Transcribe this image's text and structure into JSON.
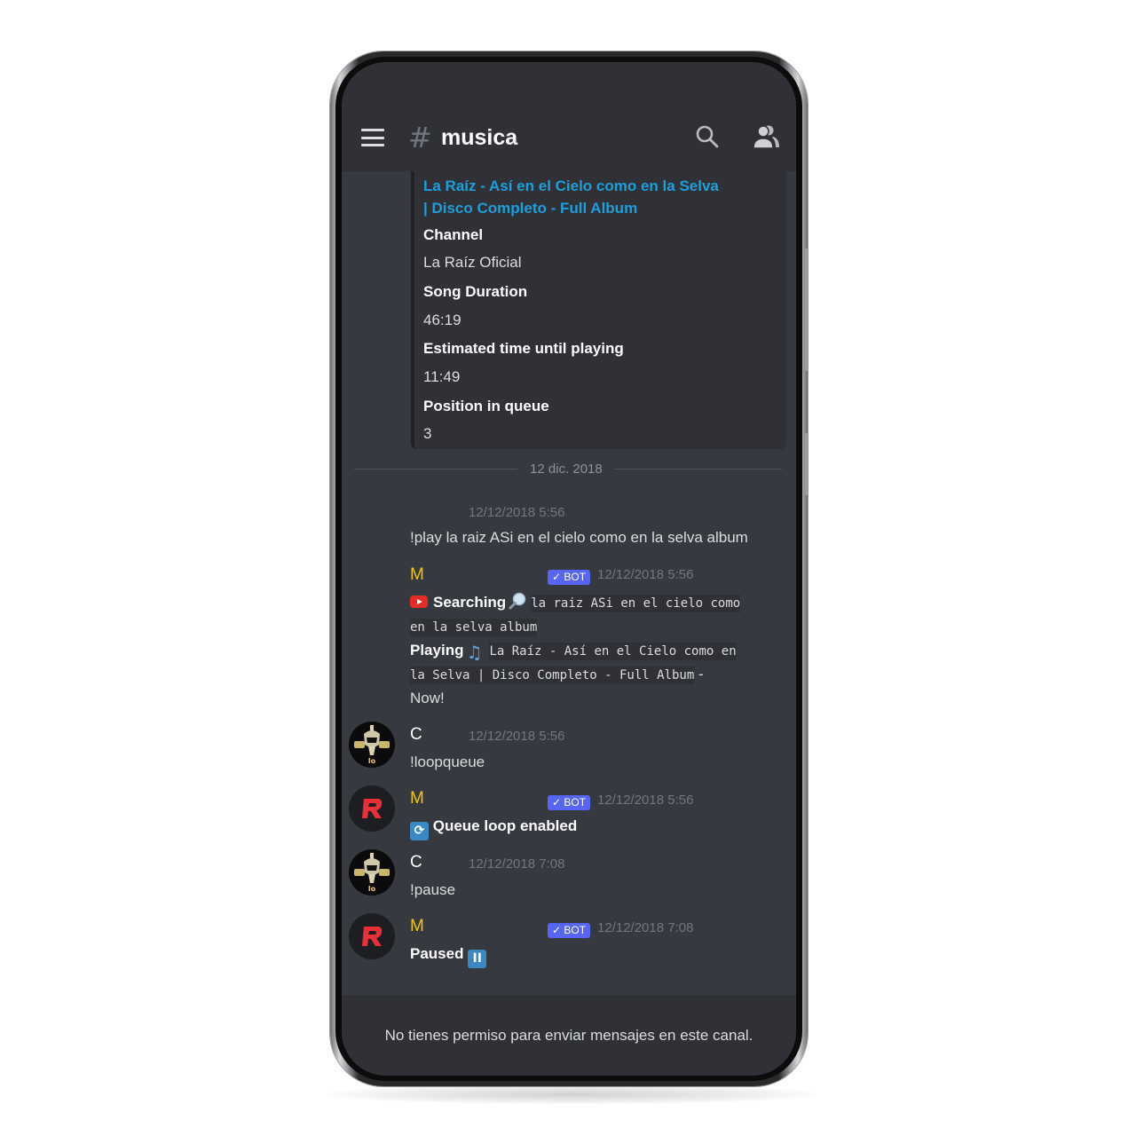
{
  "header": {
    "menu_icon": "hamburger-menu-icon",
    "hash_symbol": "#",
    "channel_name": "musica",
    "search_icon": "search-icon",
    "members_icon": "members-icon"
  },
  "embed": {
    "title_line1": "La Raíz - Así en el Cielo como en la Selva",
    "title_line2": "| Disco Completo - Full Album",
    "fields": [
      {
        "name": "Channel",
        "value": "La Raíz Oficial"
      },
      {
        "name": "Song Duration",
        "value": "46:19"
      },
      {
        "name": "Estimated time until playing",
        "value": "11:49"
      },
      {
        "name": "Position in queue",
        "value": "3"
      }
    ]
  },
  "date_divider": "12 dic. 2018",
  "messages": [
    {
      "author": "",
      "timestamp": "12/12/2018 5:56",
      "text": "!play la raiz ASi en el cielo como en la selva album"
    },
    {
      "author": "M",
      "bot_tag": "✓ BOT",
      "timestamp": "12/12/2018 5:56",
      "searching_label": "Searching",
      "searching_query_1": "la raiz ASi en el cielo como",
      "searching_query_2": "en la selva album",
      "playing_label": "Playing",
      "playing_title_1": "La Raíz - Así en el Cielo como en",
      "playing_title_2": "la Selva | Disco Completo - Full Album",
      "playing_suffix": " -",
      "now_label": "Now!"
    },
    {
      "author": "C",
      "timestamp": "12/12/2018 5:56",
      "text": "!loopqueue"
    },
    {
      "author": "M",
      "bot_tag": "✓ BOT",
      "timestamp": "12/12/2018 5:56",
      "text": "Queue loop enabled",
      "emoji": "repeat-emoji"
    },
    {
      "author": "C",
      "timestamp": "12/12/2018 7:08",
      "text": "!pause"
    },
    {
      "author": "M",
      "bot_tag": "✓ BOT",
      "timestamp": "12/12/2018 7:08",
      "text": "Paused",
      "emoji_glyph": "II"
    }
  ],
  "footer": {
    "no_permission": "No tienes permiso para enviar mensajes en este canal."
  },
  "colors": {
    "background": "#36393f",
    "header": "#2f3136",
    "link": "#1e9fdb",
    "bot_name": "#f1c40f",
    "bot_tag": "#5865f2",
    "timestamp": "#72767d"
  }
}
